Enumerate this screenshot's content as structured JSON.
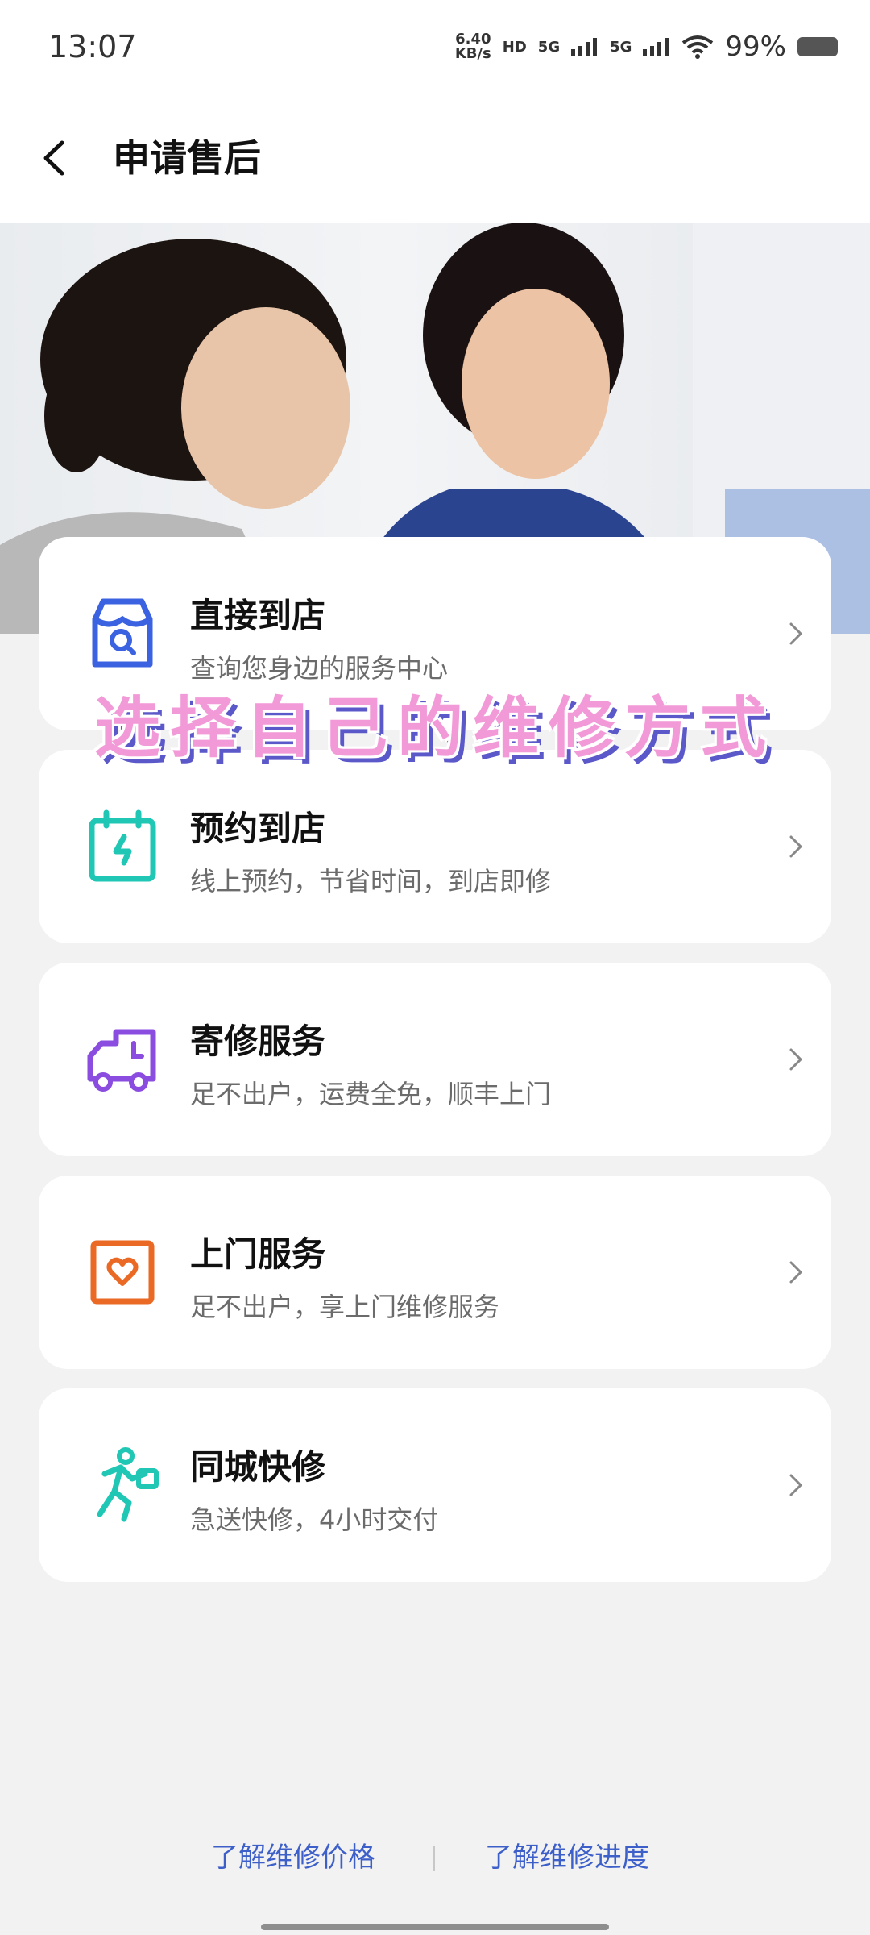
{
  "status_bar": {
    "time": "13:07",
    "net_speed_value": "6.40",
    "net_speed_unit": "KB/s",
    "hd_label": "HD",
    "signal_1": "5G",
    "signal_2": "5G",
    "battery_percent": "99%"
  },
  "header": {
    "title": "申请售后",
    "back_icon": "chevron-left-icon"
  },
  "banner": {
    "description_icon": "photo-two-women"
  },
  "overlay_caption": "选择自己的维修方式",
  "services": [
    {
      "title": "直接到店",
      "subtitle": "查询您身边的服务中心",
      "icon": "store-search-icon",
      "color": "#3b62e0"
    },
    {
      "title": "预约到店",
      "subtitle": "线上预约，节省时间，到店即修",
      "icon": "calendar-wrench-icon",
      "color": "#1fc7b4"
    },
    {
      "title": "寄修服务",
      "subtitle": "足不出户，运费全免，顺丰上门",
      "icon": "truck-clock-icon",
      "color": "#8b4de0"
    },
    {
      "title": "上门服务",
      "subtitle": "足不出户，享上门维修服务",
      "icon": "heart-box-icon",
      "color": "#ea6a25"
    },
    {
      "title": "同城快修",
      "subtitle": "急送快修，4小时交付",
      "icon": "running-courier-icon",
      "color": "#1fc7b4"
    }
  ],
  "bottom_links": {
    "price": "了解维修价格",
    "progress": "了解维修进度",
    "color": "#3d5fc9"
  }
}
